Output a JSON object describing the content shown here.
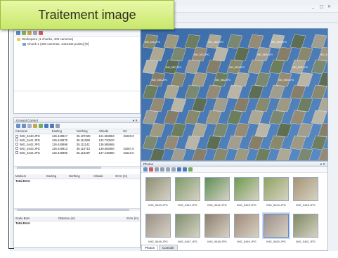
{
  "callout": {
    "title": "Traitement image"
  },
  "window": {
    "controls": [
      "_",
      "□",
      "✕"
    ]
  },
  "workspace": {
    "root": "Workspace (1 chunks, 400 cameras)",
    "chunk": "Chunk 1 (400 cameras, 1415102 points) [R]"
  },
  "ground_control": {
    "title": "Ground Control",
    "columns": [
      "Cameras",
      "Easting",
      "Northing",
      "Altitude",
      "Err"
    ],
    "rows": [
      [
        "IMG_5440.JPG",
        "126.440817",
        "35.107226",
        "121.553884",
        "31820.0"
      ],
      [
        "IMG_5441.JPG",
        "126.440879",
        "35.111599",
        "132.720520",
        ""
      ],
      [
        "IMG_5442.JPG",
        "126.440898",
        "35.111142",
        "136.585865",
        ""
      ],
      [
        "IMG_5443.JPG",
        "126.440813",
        "35.110712",
        "138.552860",
        "31857.0"
      ],
      [
        "IMG_5444.JPG",
        "126.440865",
        "35.110287",
        "137.245880",
        "31810.0"
      ]
    ],
    "markers_columns": [
      "Markers",
      "Easting",
      "Northing",
      "Altitude",
      "Error (m)"
    ],
    "markers_total": "Total Error",
    "scale_columns": [
      "Scale Bars",
      "Distance (m)",
      "Error (m)"
    ],
    "scale_total": "Total Error"
  },
  "viewport": {
    "labels": [
      "IMG_5441.JPG",
      "IMG_5452.JPG",
      "IMG_5463.JPG",
      "IMG_5474.JPG",
      "IMG_5485.JPG",
      "IMG_5496.JPG",
      "IMG_5507.JPG",
      "IMG_5518.JPG",
      "IMG_5529.JPG",
      "IMG_5531.JPG",
      "IMG_5542.JPG",
      "IMG_5553.JPG"
    ]
  },
  "photos": {
    "title": "Photos",
    "items": [
      {
        "name": "IMG_5440.JPG",
        "color": "#8c8f74"
      },
      {
        "name": "IMG_5441.JPG",
        "color": "#7d9a6a"
      },
      {
        "name": "IMG_5442.JPG",
        "color": "#5e8f55"
      },
      {
        "name": "IMG_5443.JPG",
        "color": "#6f9a4e"
      },
      {
        "name": "IMG_5444.JPG",
        "color": "#8fa462"
      },
      {
        "name": "IMG_5445.JPG",
        "color": "#a59474"
      },
      {
        "name": "IMG_5446.JPG",
        "color": "#9a8f86"
      },
      {
        "name": "IMG_5447.JPG",
        "color": "#7f8f6f"
      },
      {
        "name": "IMG_5448.JPG",
        "color": "#8e7e6f"
      },
      {
        "name": "IMG_5449.JPG",
        "color": "#a08a78"
      },
      {
        "name": "IMG_5450.JPG",
        "color": "#9c8e8a"
      },
      {
        "name": "IMG_5451.JPG",
        "color": "#7d8a62"
      }
    ],
    "tabs": [
      "Photos",
      "Console"
    ]
  },
  "colors": {
    "accent": "#3f6fa8",
    "callout": "#d5ee82"
  }
}
